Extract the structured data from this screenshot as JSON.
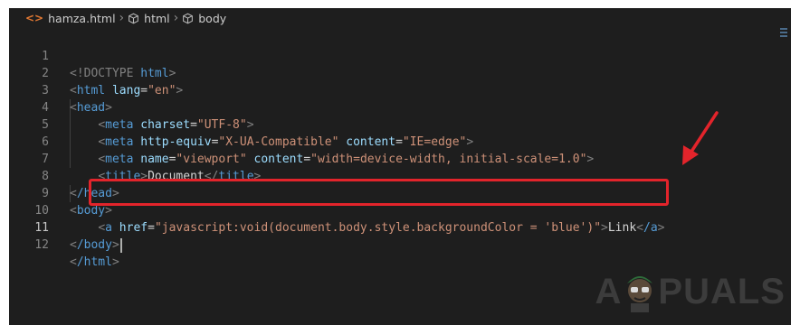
{
  "breadcrumb": {
    "file_label": "hamza.html",
    "file_icon_glyph": "<>",
    "items": [
      {
        "label": "html",
        "icon": "cube-icon"
      },
      {
        "label": "body",
        "icon": "cube-icon"
      }
    ]
  },
  "editor": {
    "current_line": 11,
    "lines": [
      {
        "n": "1"
      },
      {
        "n": "2"
      },
      {
        "n": "3"
      },
      {
        "n": "4"
      },
      {
        "n": "5"
      },
      {
        "n": "6"
      },
      {
        "n": "7"
      },
      {
        "n": "8"
      },
      {
        "n": "9"
      },
      {
        "n": "10"
      },
      {
        "n": "11"
      },
      {
        "n": "12"
      }
    ],
    "code": {
      "l1": {
        "open": "<!DOCTYPE",
        "rest": " html",
        "close": ">"
      },
      "l2": {
        "tag": "html",
        "attr": "lang",
        "eq": "=",
        "val": "\"en\""
      },
      "l3": {
        "tag": "head"
      },
      "l4": {
        "tag": "meta",
        "attr": "charset",
        "eq": "=",
        "val": "\"UTF-8\"",
        "close": "\">"
      },
      "l5": {
        "tag": "meta",
        "attr1": "http-equiv",
        "val1": "\"X-UA-Compatible\"",
        "attr2": "content",
        "val2": "\"IE=edge\""
      },
      "l6": {
        "tag": "meta",
        "attr1": "name",
        "val1": "\"viewport\"",
        "attr2": "content",
        "val2": "\"width=device-width, initial-scale=1.0\""
      },
      "l7": {
        "tag": "title",
        "text": "Document",
        "close_tag": "title"
      },
      "l8": {
        "tag": "/head"
      },
      "l9": {
        "tag": "body"
      },
      "l10": {
        "tag": "a",
        "attr": "href",
        "val": "\"javascript:void(document.body.style.backgroundColor = 'blue')\"",
        "text": "Link",
        "close_tag": "/a"
      },
      "l11": {
        "tag": "/body"
      },
      "l12": {
        "tag": "/html"
      }
    }
  },
  "watermark": {
    "text_left": "A",
    "text_right": "PUALS"
  },
  "colors": {
    "editor_bg": "#1e1e1e",
    "highlight": "#e3242b",
    "tag": "#569cd6",
    "attribute": "#9cdcfe",
    "string": "#ce9178"
  }
}
